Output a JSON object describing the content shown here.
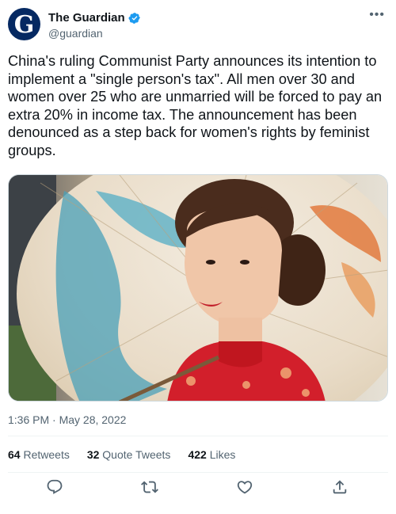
{
  "account": {
    "name": "The Guardian",
    "handle": "@guardian",
    "avatar_letter": "G",
    "brand_color": "#052962",
    "verified": true
  },
  "tweet": {
    "text": "China's ruling Communist Party announces its intention to implement a \"single person's tax\". All men over 30 and women over 25 who are unmarried will be forced to pay an extra 20% in income tax. The announcement has been denounced as a step back for women's rights by feminist groups.",
    "photo_icon": "photo-woman-with-parasol",
    "timestamp": "1:36 PM · May 28, 2022"
  },
  "stats": {
    "retweets_count": "64",
    "retweets_label": "Retweets",
    "quotes_count": "32",
    "quotes_label": "Quote Tweets",
    "likes_count": "422",
    "likes_label": "Likes"
  },
  "actions": {
    "reply_icon": "reply-icon",
    "retweet_icon": "retweet-icon",
    "like_icon": "like-icon",
    "share_icon": "share-icon"
  },
  "colors": {
    "text": "#0f1419",
    "secondary": "#536471",
    "verified": "#1d9bf0",
    "divider": "#eff3f4"
  }
}
